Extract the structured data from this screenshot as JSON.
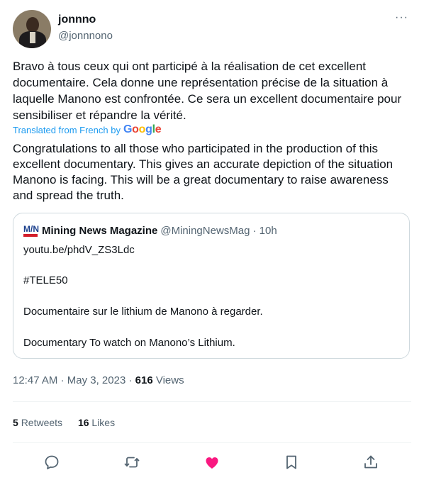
{
  "tweet": {
    "display_name": "jonnno",
    "handle": "@jonnnono",
    "more_label": "···",
    "text_original": "Bravo à tous ceux qui ont participé à la réalisation de cet excellent documentaire. Cela donne une représentation précise de la situation à laquelle Manono est confrontée. Ce sera un excellent documentaire pour sensibiliser et répandre la vérité.",
    "translated_label": "Translated from French by",
    "translated_by": "Google",
    "text_translated": "Congratulations to all those who participated in the production of this excellent documentary. This gives an accurate depiction of the situation Manono is facing. This will be a great documentary to raise awareness and spread the truth.",
    "time": "12:47 AM",
    "date": "May 3, 2023",
    "views_count": "616",
    "views_label": "Views",
    "retweets_count": "5",
    "retweets_label": "Retweets",
    "likes_count": "16",
    "likes_label": "Likes"
  },
  "quote": {
    "name": "Mining News Magazine",
    "handle": "@MiningNewsMag",
    "time": "· 10h",
    "link": "youtu.be/phdV_ZS3Ldc",
    "hashtag": "#TELE50",
    "line_fr": "Documentaire sur le lithium de Manono à regarder.",
    "line_en": "Documentary To watch on Manono’s Lithium."
  },
  "colors": {
    "accent": "#1d9bf0",
    "like": "#f91880",
    "muted": "#536471"
  },
  "icons": [
    "reply-icon",
    "retweet-icon",
    "like-icon",
    "bookmark-icon",
    "share-icon"
  ]
}
